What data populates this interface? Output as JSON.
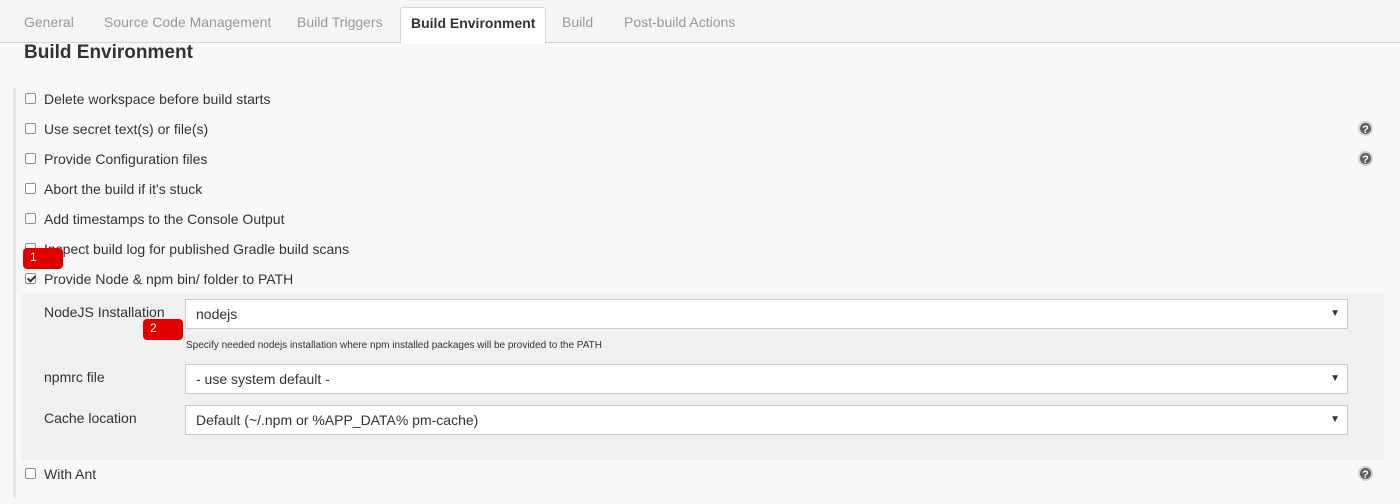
{
  "tabs": [
    "General",
    "Source Code Management",
    "Build Triggers",
    "Build Environment",
    "Build",
    "Post-build Actions"
  ],
  "section_title": "Build Environment",
  "options": [
    {
      "label": "Delete workspace before build starts",
      "checked": false
    },
    {
      "label": "Use secret text(s) or file(s)",
      "checked": false
    },
    {
      "label": "Provide Configuration files",
      "checked": false
    },
    {
      "label": "Abort the build if it's stuck",
      "checked": false
    },
    {
      "label": "Add timestamps to the Console Output",
      "checked": false
    },
    {
      "label": "Inspect build log for published Gradle build scans",
      "checked": false
    },
    {
      "label": "Provide Node & npm bin/ folder to PATH",
      "checked": true
    },
    {
      "label": "With Ant",
      "checked": false
    }
  ],
  "node_config": {
    "installation_label": "NodeJS Installation",
    "installation_value": "nodejs",
    "installation_hint": "Specify needed nodejs installation where npm installed packages will be provided to the PATH",
    "npmrc_label": "npmrc file",
    "npmrc_value": "- use system default -",
    "cache_label": "Cache location",
    "cache_value": "Default (~/.npm or %APP_DATA% pm-cache)"
  },
  "annotations": [
    "1",
    "2"
  ],
  "help_glyph": "?",
  "dropdown_glyph": "▼",
  "colors": {
    "annotation": "#e00000",
    "help_icon": "#606060"
  }
}
